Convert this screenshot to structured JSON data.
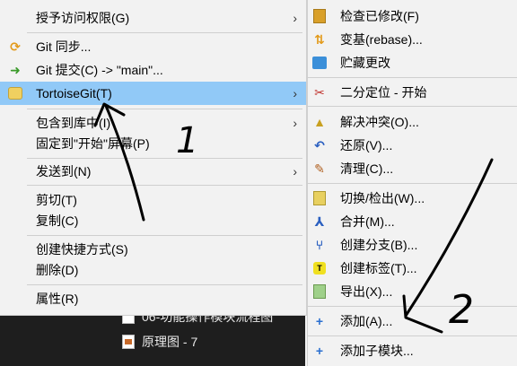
{
  "explorer": {
    "files": [
      {
        "name": "06-功能操作模块流程图"
      },
      {
        "name": "原理图 - 7"
      }
    ]
  },
  "main_menu": {
    "items": [
      {
        "label": "授予访问权限(G)",
        "icon": "share-icon",
        "has_submenu": true
      },
      {
        "label": "Git 同步...",
        "icon": "git-sync-icon",
        "has_submenu": false
      },
      {
        "label": "Git 提交(C) -> \"main\"...",
        "icon": "git-commit-icon",
        "has_submenu": false
      },
      {
        "label": "TortoiseGit(T)",
        "icon": "tortoisegit-icon",
        "has_submenu": true,
        "highlighted": true
      },
      {
        "label": "包含到库中(I)",
        "icon": "",
        "has_submenu": true
      },
      {
        "label": "固定到\"开始\"屏幕(P)",
        "icon": "",
        "has_submenu": false
      },
      {
        "label": "发送到(N)",
        "icon": "",
        "has_submenu": true
      },
      {
        "label": "剪切(T)",
        "icon": "",
        "has_submenu": false
      },
      {
        "label": "复制(C)",
        "icon": "",
        "has_submenu": false
      },
      {
        "label": "创建快捷方式(S)",
        "icon": "",
        "has_submenu": false
      },
      {
        "label": "删除(D)",
        "icon": "",
        "has_submenu": false
      },
      {
        "label": "属性(R)",
        "icon": "",
        "has_submenu": false
      }
    ]
  },
  "sub_menu": {
    "items": [
      {
        "label": "检查已修改(F)",
        "icon": "check-modifications-icon"
      },
      {
        "label": "变基(rebase)...",
        "icon": "rebase-icon"
      },
      {
        "label": "贮藏更改",
        "icon": "stash-icon"
      },
      {
        "label": "二分定位 - 开始",
        "icon": "bisect-icon"
      },
      {
        "label": "解决冲突(O)...",
        "icon": "resolve-icon"
      },
      {
        "label": "还原(V)...",
        "icon": "revert-icon"
      },
      {
        "label": "清理(C)...",
        "icon": "clean-icon"
      },
      {
        "label": "切换/检出(W)...",
        "icon": "switch-icon"
      },
      {
        "label": "合并(M)...",
        "icon": "merge-icon"
      },
      {
        "label": "创建分支(B)...",
        "icon": "branch-icon"
      },
      {
        "label": "创建标签(T)...",
        "icon": "tag-icon"
      },
      {
        "label": "导出(X)...",
        "icon": "export-icon"
      },
      {
        "label": "添加(A)...",
        "icon": "add-icon"
      },
      {
        "label": "添加子模块...",
        "icon": "add-submodule-icon"
      }
    ],
    "tag_icon_letter": "T"
  },
  "annotations": {
    "mark_1": "1",
    "mark_2": "2"
  },
  "colors": {
    "menu_bg": "#f2f2f2",
    "highlight": "#91c9f7",
    "explorer_bg": "#1e1e1e"
  }
}
